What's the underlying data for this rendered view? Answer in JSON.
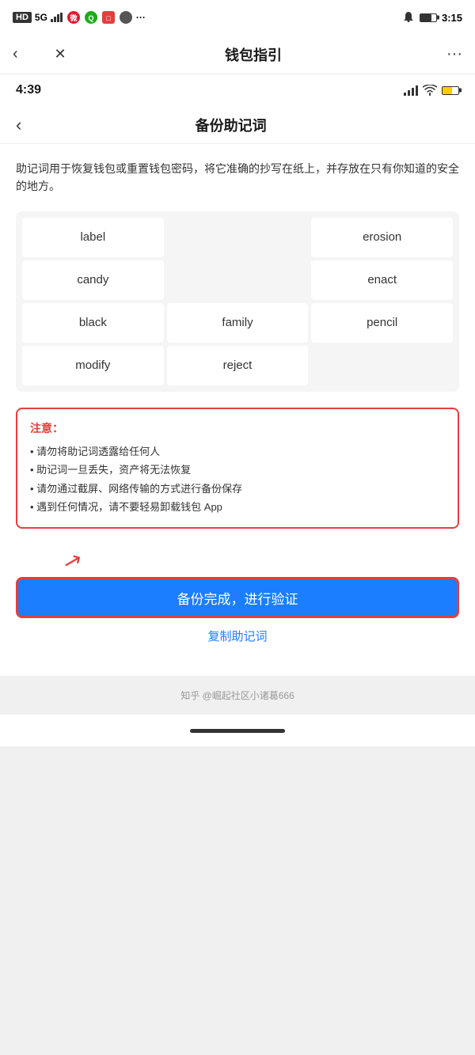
{
  "outer_status": {
    "left_text": "HD 5G",
    "time": "3:15",
    "network": "5G"
  },
  "nav": {
    "title": "钱包指引",
    "back_label": "‹",
    "close_label": "✕",
    "more_label": "···"
  },
  "inner_status": {
    "time": "4:39"
  },
  "inner_nav": {
    "title": "备份助记词",
    "back_label": "‹"
  },
  "description": "助记词用于恢复钱包或重置钱包密码，将它准确的抄写在纸上，并存放在只有你知道的安全的地方。",
  "mnemonic": {
    "words": [
      "label",
      "",
      "erosion",
      "candy",
      "",
      "enact",
      "black",
      "family",
      "pencil",
      "modify",
      "reject",
      ""
    ]
  },
  "warning": {
    "title": "注意：",
    "items": [
      "• 请勿将助记词透露给任何人",
      "• 助记词一旦丢失，资产将无法恢复",
      "• 请勿通过截屏、网络传输的方式进行备份保存",
      "• 遇到任何情况，请不要轻易卸载钱包 App"
    ]
  },
  "verify_button": "备份完成，进行验证",
  "copy_link": "复制助记词",
  "footer": "知乎 @崛起社区小诸葛666"
}
